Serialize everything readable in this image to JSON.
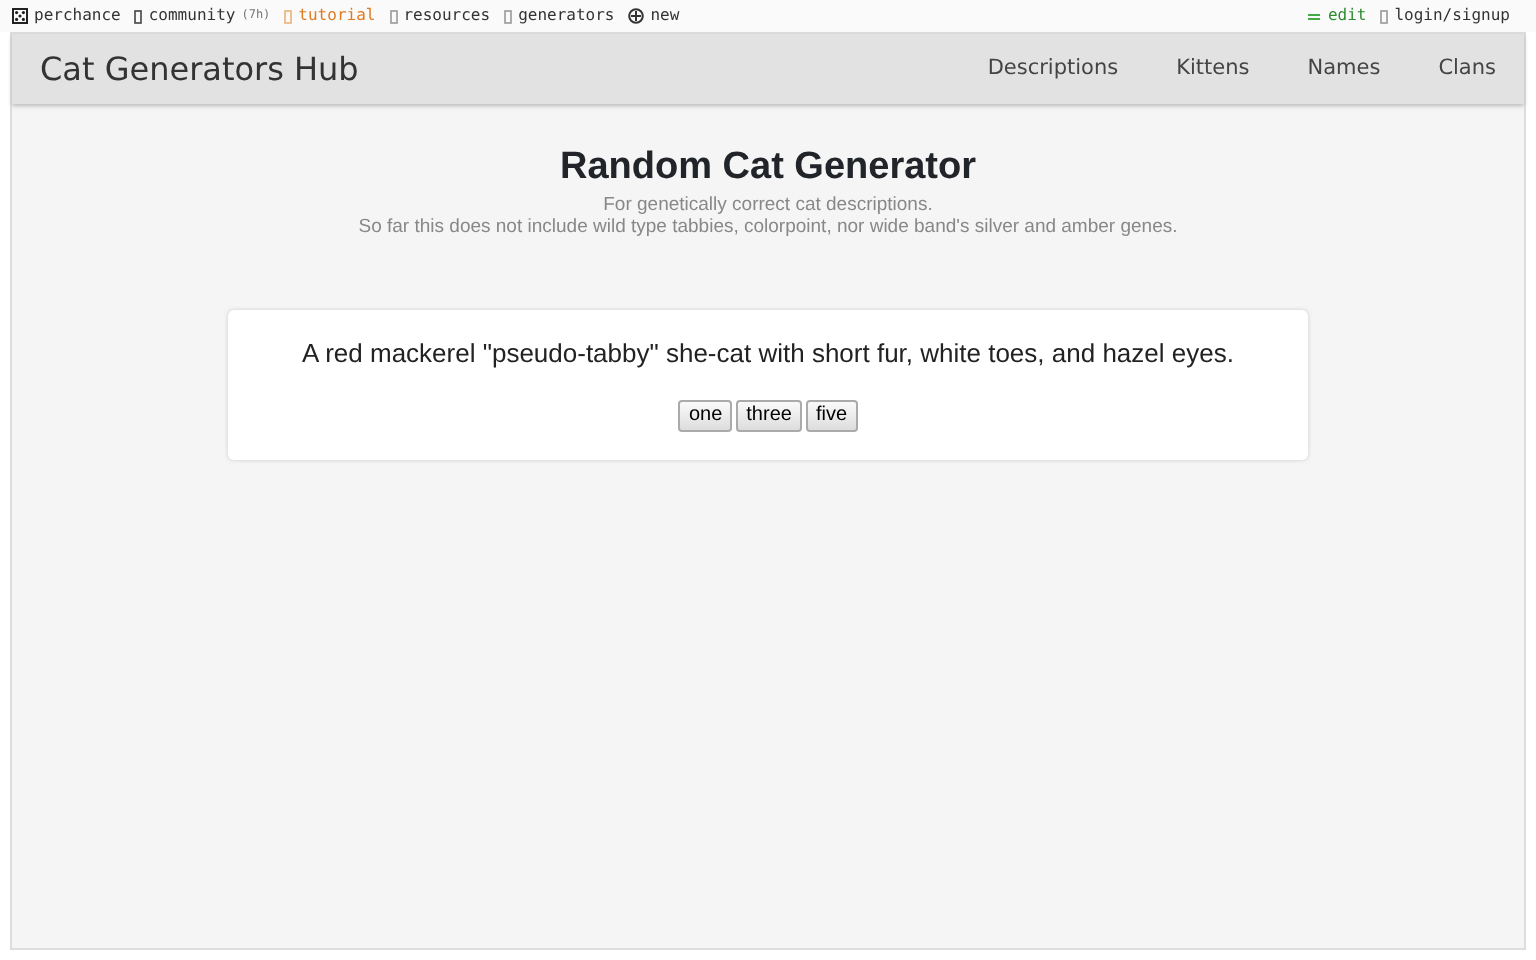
{
  "top_bar": {
    "left": [
      {
        "label": "perchance",
        "color": "#333333"
      },
      {
        "label": "community",
        "note": "(7h)",
        "color": "#333333"
      },
      {
        "label": "tutorial",
        "color": "#e07a1f"
      },
      {
        "label": "resources",
        "color": "#333333"
      },
      {
        "label": "generators",
        "color": "#333333"
      },
      {
        "label": "new",
        "color": "#333333"
      }
    ],
    "right": [
      {
        "label": "edit",
        "color": "#2e8b2e"
      },
      {
        "label": "login/signup",
        "color": "#333333"
      }
    ]
  },
  "navbar": {
    "brand": "Cat Generators Hub",
    "links": [
      "Descriptions",
      "Kittens",
      "Names",
      "Clans"
    ]
  },
  "header": {
    "title": "Random Cat Generator",
    "subtitle": [
      "For genetically correct cat descriptions.",
      "So far this does not include wild type tabbies, colorpoint, nor wide band's silver and amber genes."
    ]
  },
  "output": {
    "text": "A red mackerel \"pseudo-tabby\" she-cat with short fur, white toes, and hazel eyes.",
    "buttons": [
      "one",
      "three",
      "five"
    ]
  }
}
